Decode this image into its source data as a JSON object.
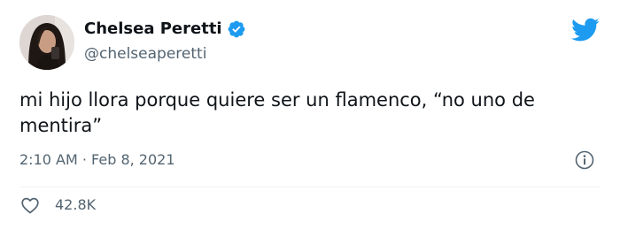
{
  "tweet": {
    "author": {
      "display_name": "Chelsea Peretti",
      "handle": "@chelseaperetti",
      "verified": true
    },
    "text": "mi hijo llora porque quiere ser un flamenco, “no uno de mentira”",
    "timestamp": "2:10 AM · Feb 8, 2021",
    "like_count": "42.8K"
  },
  "icons": {
    "verified": "verified-badge-icon",
    "logo": "twitter-bird-icon",
    "info": "info-icon",
    "like": "heart-icon"
  },
  "colors": {
    "brand_blue": "#1d9bf0",
    "text_primary": "#0f1419",
    "text_secondary": "#536471",
    "divider": "#eff3f4"
  }
}
